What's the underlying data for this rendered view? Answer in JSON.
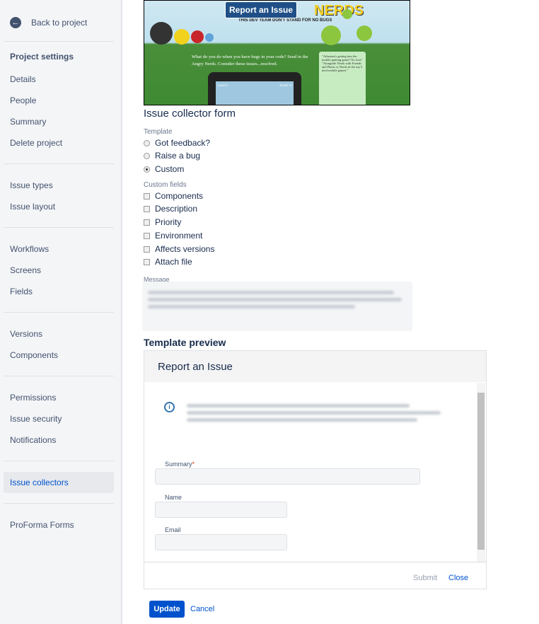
{
  "sidebar": {
    "back": "Back to project",
    "heading": "Project settings",
    "groups": [
      [
        "Details",
        "People",
        "Summary",
        "Delete project"
      ],
      [
        "Issue types",
        "Issue layout"
      ],
      [
        "Workflows",
        "Screens",
        "Fields"
      ],
      [
        "Versions",
        "Components"
      ],
      [
        "Permissions",
        "Issue security",
        "Notifications"
      ],
      [
        "Issue collectors"
      ],
      [
        "ProForma Forms"
      ]
    ],
    "selected": "Issue collectors"
  },
  "banner": {
    "button": "Report an Issue",
    "logo": "NERDS",
    "tagline": "THIS DEV TEAM DON'T STAND FOR NO BUGS",
    "text": "What do you do when you have bugs in your code? Send in the Angry Nerds. Consider these issues...resolved.",
    "quote": "\"Atlassian's getting into the mobile gaming game? No foul.\" \"Alongside Nerds with Friends and Plants vs Nerds in the top 5 nerd mobile games.\"",
    "screen_left": "Level 1",
    "screen_right": "Score: 0"
  },
  "form": {
    "title": "Issue collector form",
    "template_label": "Template",
    "templates": [
      "Got feedback?",
      "Raise a bug",
      "Custom"
    ],
    "template_selected": 2,
    "custom_fields_label": "Custom fields",
    "custom_fields": [
      "Components",
      "Description",
      "Priority",
      "Environment",
      "Affects versions",
      "Attach file"
    ],
    "message_label": "Message"
  },
  "preview": {
    "title": "Template preview",
    "dialog_title": "Report an Issue",
    "summary_label": "Summary",
    "required_mark": "*",
    "name_label": "Name",
    "email_label": "Email",
    "submit": "Submit",
    "close": "Close"
  },
  "actions": {
    "update": "Update",
    "cancel": "Cancel"
  }
}
